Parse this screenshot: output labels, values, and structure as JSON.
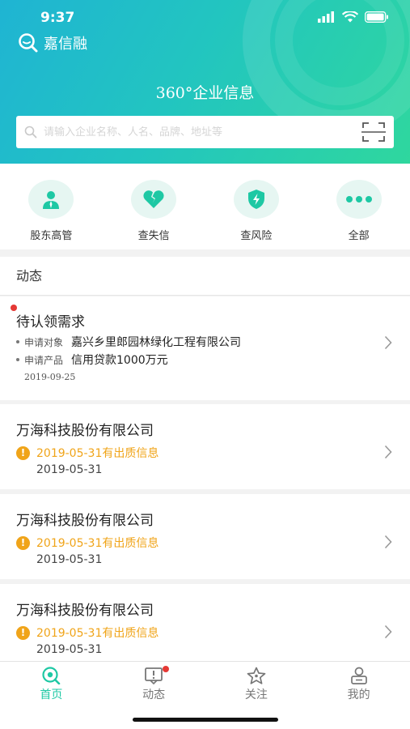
{
  "status_bar": {
    "time": "9:37"
  },
  "brand": {
    "name": "嘉信融"
  },
  "header": {
    "slogan": "360°企业信息"
  },
  "search": {
    "placeholder": "请输入企业名称、人名、品牌、地址等"
  },
  "quick_menu": [
    {
      "label": "股东高管",
      "icon": "executive-icon"
    },
    {
      "label": "查失信",
      "icon": "broken-heart-icon"
    },
    {
      "label": "查风险",
      "icon": "risk-shield-icon"
    },
    {
      "label": "全部",
      "icon": "more-dots-icon"
    }
  ],
  "feed": {
    "section_title": "动态",
    "demand": {
      "title": "待认领需求",
      "target_key": "申请对象",
      "target_value": "嘉兴乡里郎园林绿化工程有限公司",
      "product_key": "申请产品",
      "product_value": "信用贷款1000万元",
      "date": "2019-09-25"
    },
    "items": [
      {
        "company": "万海科技股份有限公司",
        "notice": "2019-05-31有出质信息",
        "date": "2019-05-31"
      },
      {
        "company": "万海科技股份有限公司",
        "notice": "2019-05-31有出质信息",
        "date": "2019-05-31"
      },
      {
        "company": "万海科技股份有限公司",
        "notice": "2019-05-31有出质信息",
        "date": "2019-05-31"
      }
    ]
  },
  "tabbar": [
    {
      "label": "首页",
      "icon": "home-eye-icon",
      "active": true
    },
    {
      "label": "动态",
      "icon": "notice-icon",
      "badge": true
    },
    {
      "label": "关注",
      "icon": "star-icon"
    },
    {
      "label": "我的",
      "icon": "profile-icon"
    }
  ],
  "colors": {
    "accent": "#1ec8a4",
    "warning": "#f0a419",
    "badge": "#e53935"
  }
}
